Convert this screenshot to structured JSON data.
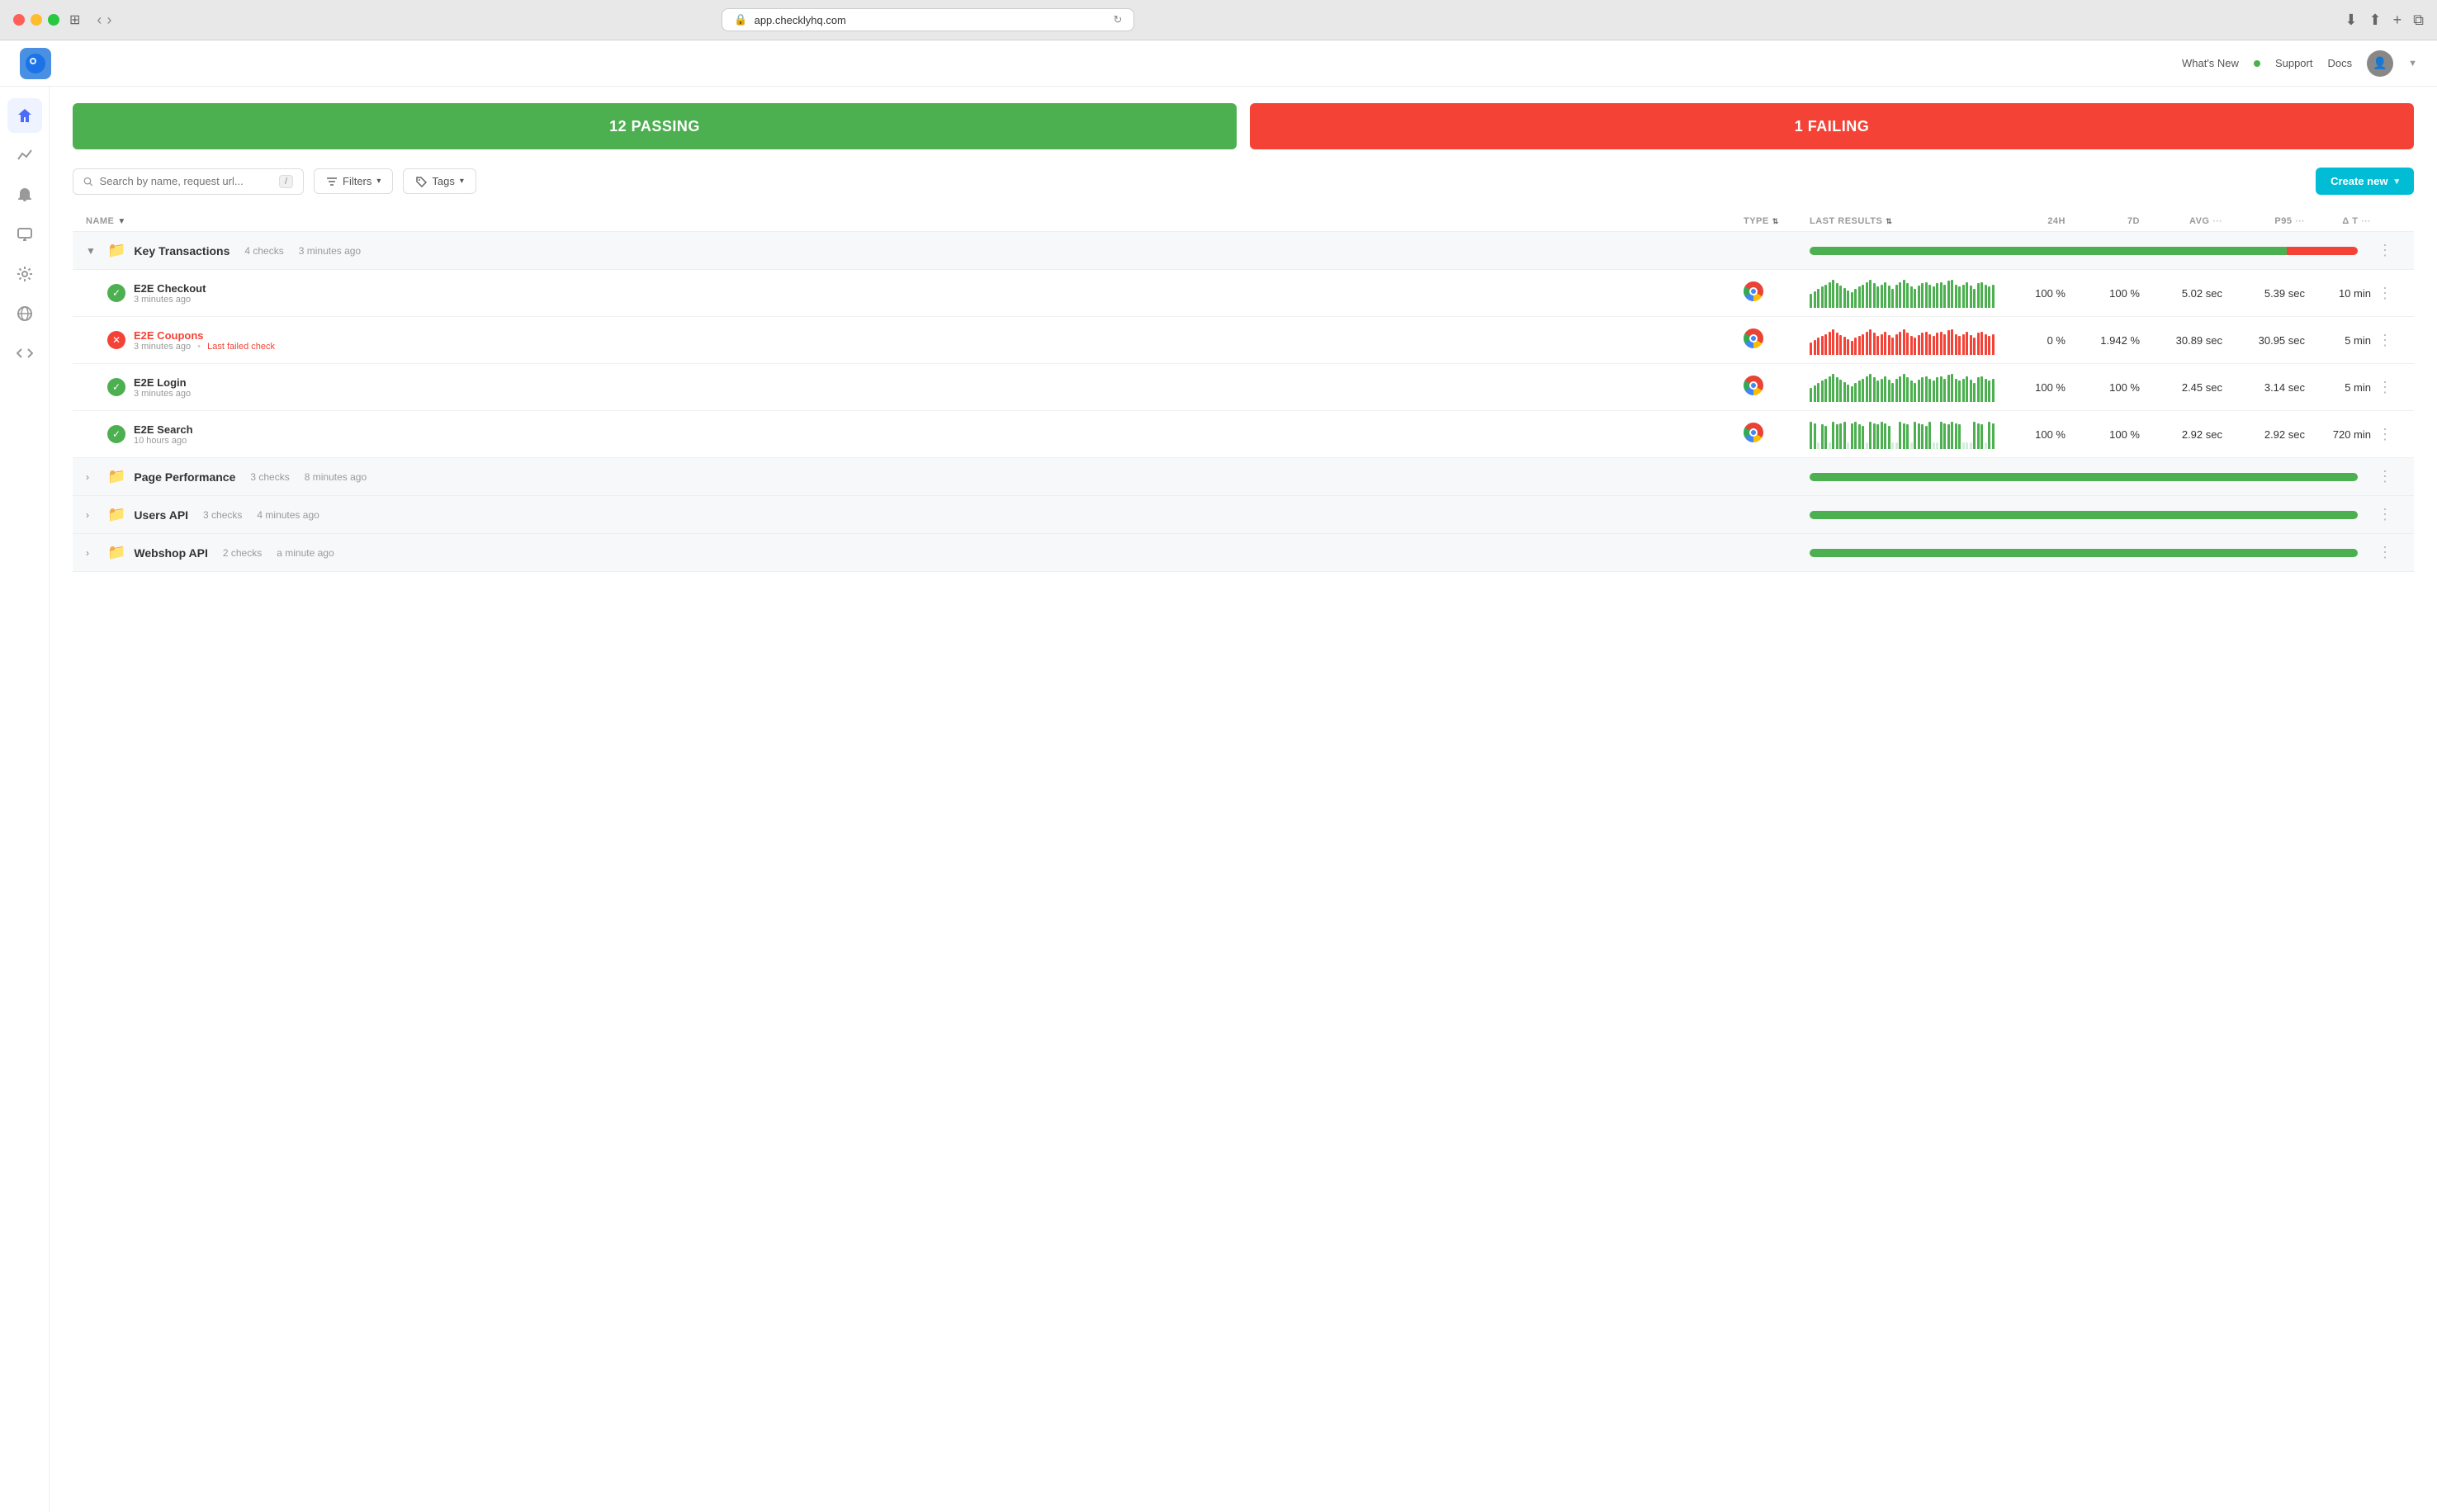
{
  "browser": {
    "url": "app.checklyhq.com",
    "refresh_icon": "↻"
  },
  "topnav": {
    "whats_new": "What's New",
    "dot_status": "green",
    "support": "Support",
    "docs": "Docs"
  },
  "summary": {
    "passing_label": "12 PASSING",
    "failing_label": "1 FAILING"
  },
  "toolbar": {
    "search_placeholder": "Search by name, request url...",
    "shortcut": "/",
    "filters_label": "Filters",
    "tags_label": "Tags",
    "create_new_label": "Create new"
  },
  "table": {
    "headers": {
      "name": "NAME",
      "type": "TYPE",
      "last_results": "LAST RESULTS",
      "h24": "24H",
      "d7": "7D",
      "avg": "AVG",
      "p95": "P95",
      "delta_t": "Δ T"
    }
  },
  "groups": [
    {
      "id": "key-transactions",
      "name": "Key Transactions",
      "checks_count": "4 checks",
      "time_ago": "3 minutes ago",
      "expanded": true,
      "pass_pct": 87,
      "fail_pct": 13,
      "checks": [
        {
          "id": "e2e-checkout",
          "name": "E2E Checkout",
          "status": "pass",
          "time_ago": "3 minutes ago",
          "failed_label": "",
          "h24": "100 %",
          "d7": "100 %",
          "avg": "5.02 sec",
          "p95": "5.39 sec",
          "delta_t": "10 min",
          "bars": [
            1,
            1,
            1,
            1,
            1,
            1,
            1,
            1,
            1,
            1,
            1,
            1,
            1,
            1,
            1,
            1,
            1,
            1,
            1,
            1,
            1,
            1,
            1,
            1,
            1,
            1,
            1,
            1,
            1,
            1,
            1,
            1,
            1,
            1,
            1,
            1,
            1,
            1,
            1,
            1,
            1,
            1,
            1,
            1,
            1,
            1,
            1,
            1,
            1,
            1
          ]
        },
        {
          "id": "e2e-coupons",
          "name": "E2E Coupons",
          "status": "fail",
          "time_ago": "3 minutes ago",
          "failed_label": "Last failed check",
          "h24": "0 %",
          "d7": "1.942 %",
          "avg": "30.89 sec",
          "p95": "30.95 sec",
          "delta_t": "5 min",
          "bars": [
            0,
            0,
            0,
            0,
            0,
            0,
            0,
            0,
            0,
            0,
            0,
            0,
            0,
            0,
            0,
            0,
            0,
            0,
            0,
            0,
            0,
            0,
            0,
            0,
            0,
            0,
            0,
            0,
            0,
            0,
            0,
            0,
            0,
            0,
            0,
            0,
            0,
            0,
            0,
            0,
            0,
            0,
            0,
            0,
            0,
            0,
            0,
            0,
            0,
            0
          ]
        },
        {
          "id": "e2e-login",
          "name": "E2E Login",
          "status": "pass",
          "time_ago": "3 minutes ago",
          "failed_label": "",
          "h24": "100 %",
          "d7": "100 %",
          "avg": "2.45 sec",
          "p95": "3.14 sec",
          "delta_t": "5 min",
          "bars": [
            1,
            1,
            1,
            1,
            1,
            1,
            1,
            1,
            1,
            1,
            1,
            1,
            1,
            1,
            1,
            1,
            1,
            1,
            1,
            1,
            1,
            1,
            1,
            1,
            1,
            1,
            1,
            1,
            1,
            1,
            1,
            1,
            1,
            1,
            1,
            1,
            1,
            1,
            1,
            1,
            1,
            1,
            1,
            1,
            1,
            1,
            1,
            1,
            1,
            1
          ]
        },
        {
          "id": "e2e-search",
          "name": "E2E Search",
          "status": "pass",
          "time_ago": "10 hours ago",
          "failed_label": "",
          "h24": "100 %",
          "d7": "100 %",
          "avg": "2.92 sec",
          "p95": "2.92 sec",
          "delta_t": "720 min",
          "bars": [
            1,
            1,
            0,
            1,
            1,
            0,
            1,
            1,
            1,
            1,
            0,
            1,
            1,
            1,
            1,
            0,
            1,
            1,
            1,
            1,
            1,
            1,
            0,
            0,
            1,
            1,
            1,
            0,
            1,
            1,
            1,
            1,
            1,
            0,
            0,
            1,
            1,
            1,
            1,
            1,
            1,
            0,
            0,
            0,
            1,
            1,
            1,
            0,
            1,
            1
          ]
        }
      ]
    },
    {
      "id": "page-performance",
      "name": "Page Performance",
      "checks_count": "3 checks",
      "time_ago": "8 minutes ago",
      "expanded": false,
      "pass_pct": 100,
      "fail_pct": 0,
      "checks": []
    },
    {
      "id": "users-api",
      "name": "Users API",
      "checks_count": "3 checks",
      "time_ago": "4 minutes ago",
      "expanded": false,
      "pass_pct": 100,
      "fail_pct": 0,
      "checks": []
    },
    {
      "id": "webshop-api",
      "name": "Webshop API",
      "checks_count": "2 checks",
      "time_ago": "a minute ago",
      "expanded": false,
      "pass_pct": 100,
      "fail_pct": 0,
      "checks": []
    }
  ],
  "sidebar": {
    "items": [
      {
        "id": "home",
        "icon": "⌂",
        "active": true
      },
      {
        "id": "analytics",
        "icon": "∿"
      },
      {
        "id": "alerts",
        "icon": "🔔"
      },
      {
        "id": "monitors",
        "icon": "🖥"
      },
      {
        "id": "settings",
        "icon": "⚙"
      },
      {
        "id": "globe",
        "icon": "🌐"
      },
      {
        "id": "code",
        "icon": "</>"
      }
    ]
  },
  "colors": {
    "pass_green": "#4caf50",
    "fail_red": "#f44336",
    "pass_bar": "#4caf50",
    "fail_bar": "#f44336",
    "empty_bar": "#d4edda",
    "cyan": "#00bcd4",
    "folder_blue": "#5b9bd5"
  }
}
